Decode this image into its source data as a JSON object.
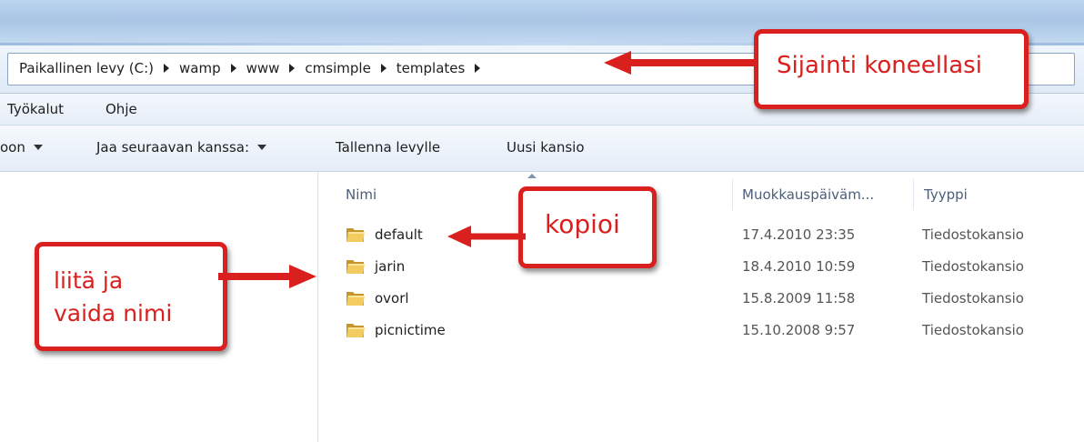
{
  "address": {
    "crumbs": [
      "Paikallinen levy (C:)",
      "wamp",
      "www",
      "cmsimple",
      "templates"
    ]
  },
  "menu": {
    "items": [
      "Työkalut",
      "Ohje"
    ]
  },
  "toolbar": {
    "organize_partial": "oon",
    "share": "Jaa seuraavan kanssa:",
    "burn": "Tallenna levylle",
    "new_folder": "Uusi kansio"
  },
  "columns": {
    "name": "Nimi",
    "modified": "Muokkauspäiväm...",
    "type": "Tyyppi"
  },
  "files": [
    {
      "name": "default",
      "date": "17.4.2010 23:35",
      "type": "Tiedostokansio"
    },
    {
      "name": "jarin",
      "date": "18.4.2010 10:59",
      "type": "Tiedostokansio"
    },
    {
      "name": "ovorl",
      "date": "15.8.2009 11:58",
      "type": "Tiedostokansio"
    },
    {
      "name": "picnictime",
      "date": "15.10.2008 9:57",
      "type": "Tiedostokansio"
    }
  ],
  "annotations": {
    "location": "Sijainti koneellasi",
    "copy": "kopioi",
    "paste_line1": "liitä ja",
    "paste_line2": "vaida nimi"
  },
  "colors": {
    "annotation_red": "#d9201e",
    "folder_yellow": "#e8b93a"
  },
  "icons": {
    "folder": "folder-icon",
    "breadcrumb_separator": "chevron-right-icon",
    "dropdown": "chevron-down-icon"
  }
}
